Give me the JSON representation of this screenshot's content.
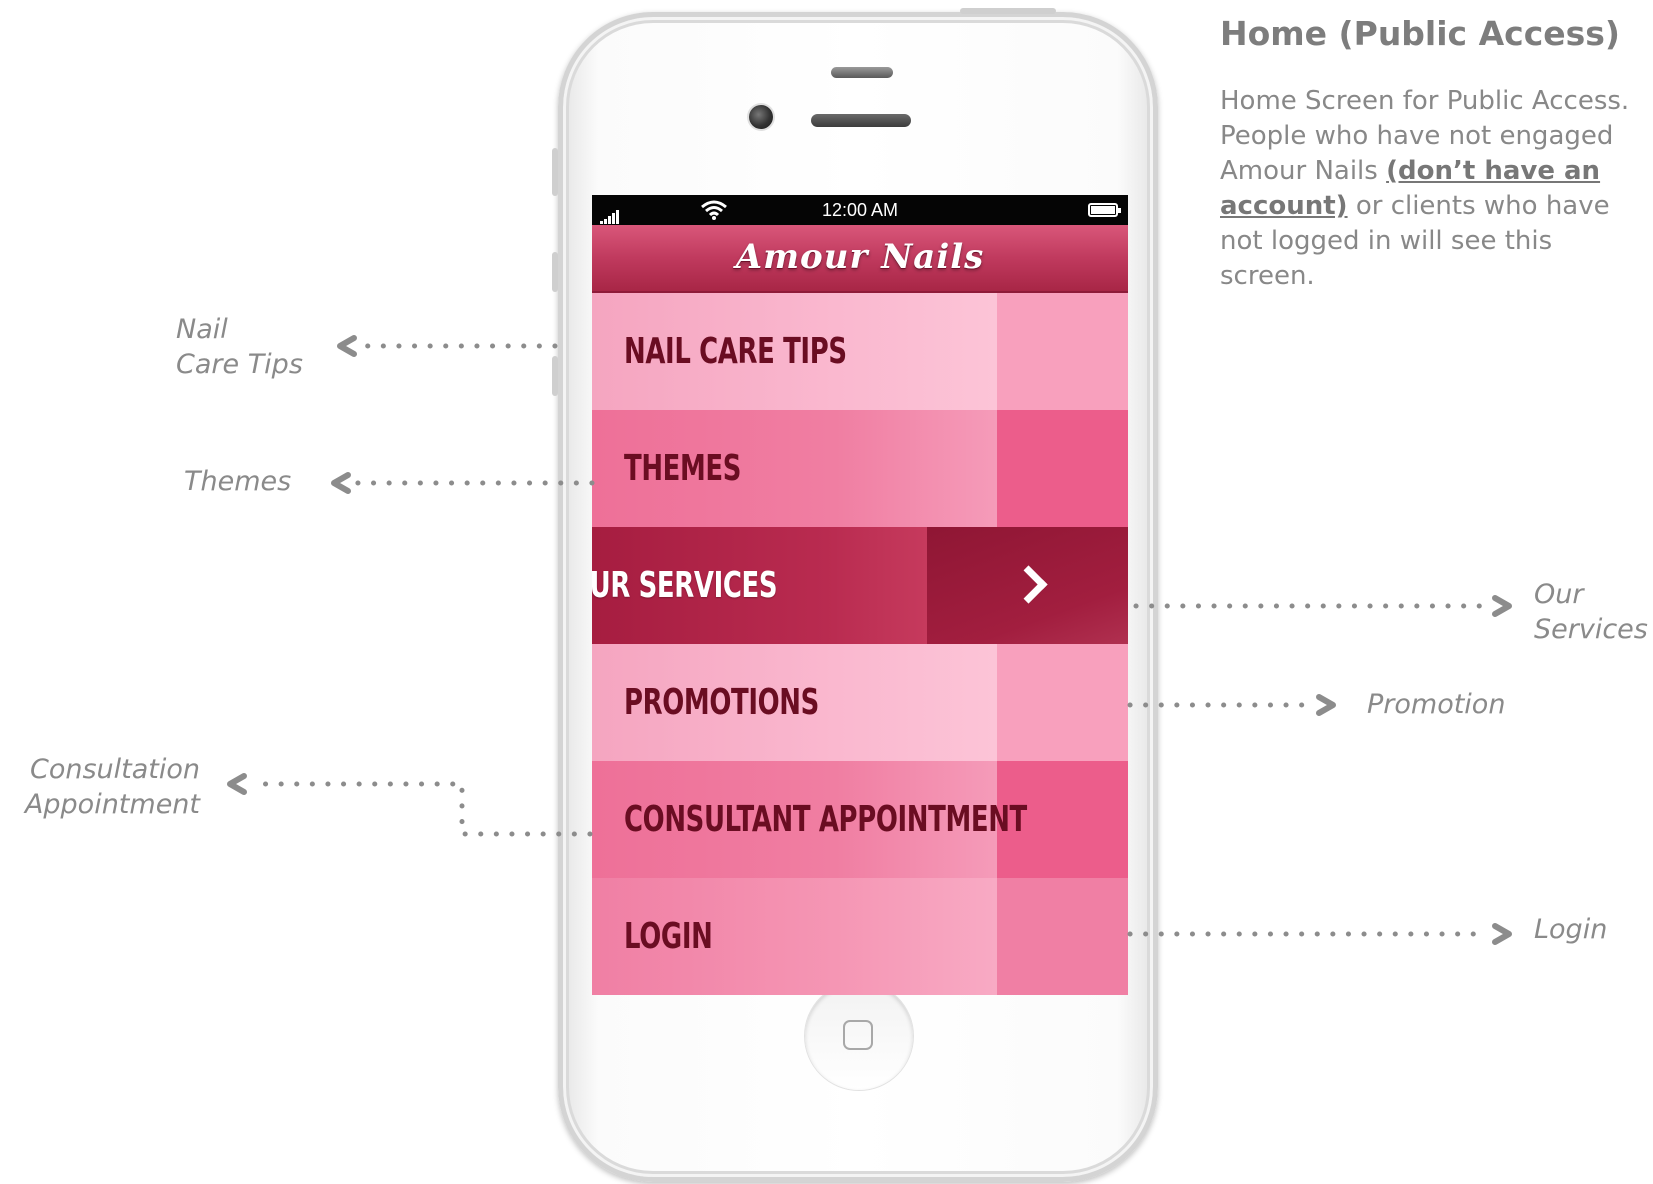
{
  "info": {
    "title": "Home (Public Access)",
    "desc_part1": "Home Screen for Public Access. People who have not engaged Amour Nails ",
    "desc_emphasis": "(don’t have an account)",
    "desc_part2": " or clients who have not logged in will see this screen."
  },
  "annotations": {
    "nail_care_line1": "Nail",
    "nail_care_line2": "Care Tips",
    "themes": "Themes",
    "consultation_line1": "Consultation",
    "consultation_line2": "Appointment",
    "our_services_line1": "Our",
    "our_services_line2": "Services",
    "promotion": "Promotion",
    "login": "Login"
  },
  "status_bar": {
    "time": "12:00 AM"
  },
  "app": {
    "logo": "Amour Nails",
    "menu": [
      {
        "label": "NAIL CARE TIPS"
      },
      {
        "label": "THEMES"
      },
      {
        "label": "OUR SERVICES"
      },
      {
        "label": "PROMOTIONS"
      },
      {
        "label": "CONSULTANT APPOINTMENT"
      },
      {
        "label": "LOGIN"
      }
    ]
  },
  "colors": {
    "accent": "#a61d40",
    "light_pink": "#fab8cf",
    "mid_pink": "#ee7098",
    "annotation_gray": "#8a8a8a"
  }
}
